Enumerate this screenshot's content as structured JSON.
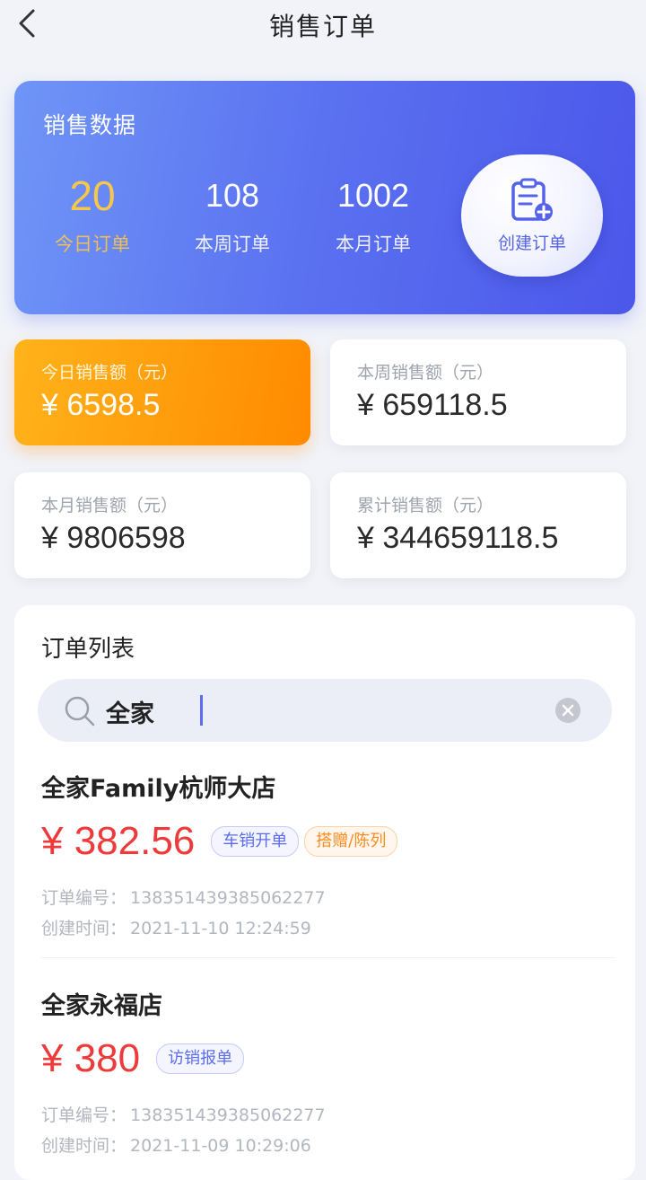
{
  "header": {
    "title": "销售订单"
  },
  "sales": {
    "title": "销售数据",
    "stats": [
      {
        "value": "20",
        "label": "今日订单"
      },
      {
        "value": "108",
        "label": "本周订单"
      },
      {
        "value": "1002",
        "label": "本月订单"
      }
    ],
    "create_label": "创建订单"
  },
  "amounts": [
    {
      "label": "今日销售额（元）",
      "value": "¥ 6598.5"
    },
    {
      "label": "本周销售额（元）",
      "value": "¥ 659118.5"
    },
    {
      "label": "本月销售额（元）",
      "value": "¥ 9806598"
    },
    {
      "label": "累计销售额（元）",
      "value": "¥ 344659118.5"
    }
  ],
  "list": {
    "title": "订单列表",
    "search_value": "全家",
    "orders": [
      {
        "name": "全家Family杭师大店",
        "price": "¥ 382.56",
        "tags": [
          "车销开单",
          "搭赠/陈列"
        ],
        "order_no_label": "订单编号：",
        "order_no": "138351439385062277",
        "created_label": "创建时间：",
        "created": "2021-11-10 12:24:59"
      },
      {
        "name": "全家永福店",
        "price": "¥ 380",
        "tags": [
          "访销报单"
        ],
        "order_no_label": "订单编号：",
        "order_no": "138351439385062277",
        "created_label": "创建时间：",
        "created": "2021-11-09 10:29:06"
      }
    ]
  },
  "colors": {
    "accent_blue": "#5a6cf0",
    "highlight_orange": "#ff8a00",
    "price_red": "#ee3a3a",
    "today_gold": "#f7c64b"
  }
}
